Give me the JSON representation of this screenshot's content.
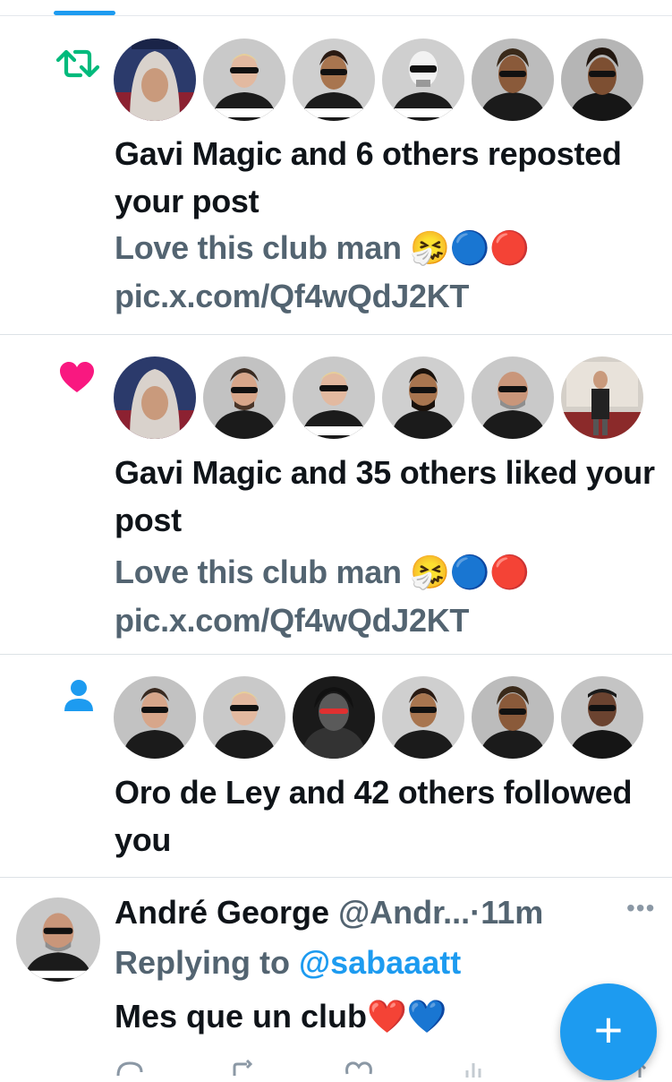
{
  "notifications": [
    {
      "type_icon": "repost-icon",
      "headline": "Gavi Magic and 6 others reposted your post",
      "snippet_text": "Love this club man",
      "snippet_emoji": "🤧🔵🔴",
      "snippet_link": "pic.x.com/Qf4wQdJ2KT"
    },
    {
      "type_icon": "heart-icon",
      "headline": "Gavi Magic and 35 others liked your post",
      "snippet_text": "Love this club man",
      "snippet_emoji": "🤧🔵🔴",
      "snippet_link": "pic.x.com/Qf4wQdJ2KT"
    },
    {
      "type_icon": "person-icon",
      "headline": "Oro de Ley and 42 others followed you"
    }
  ],
  "tweet": {
    "name": "André George",
    "handle": "@Andr...",
    "separator": "·",
    "time": "11m",
    "replying_prefix": "Replying to",
    "replying_handle": "@sabaaatt",
    "body_text": "Mes que un club",
    "body_emoji": "❤️💙"
  },
  "fab": {
    "label": "+"
  },
  "colors": {
    "accent": "#1d9bf0",
    "repost": "#00ba7c",
    "like": "#f91880",
    "text": "#0f1419",
    "muted": "#536471"
  }
}
